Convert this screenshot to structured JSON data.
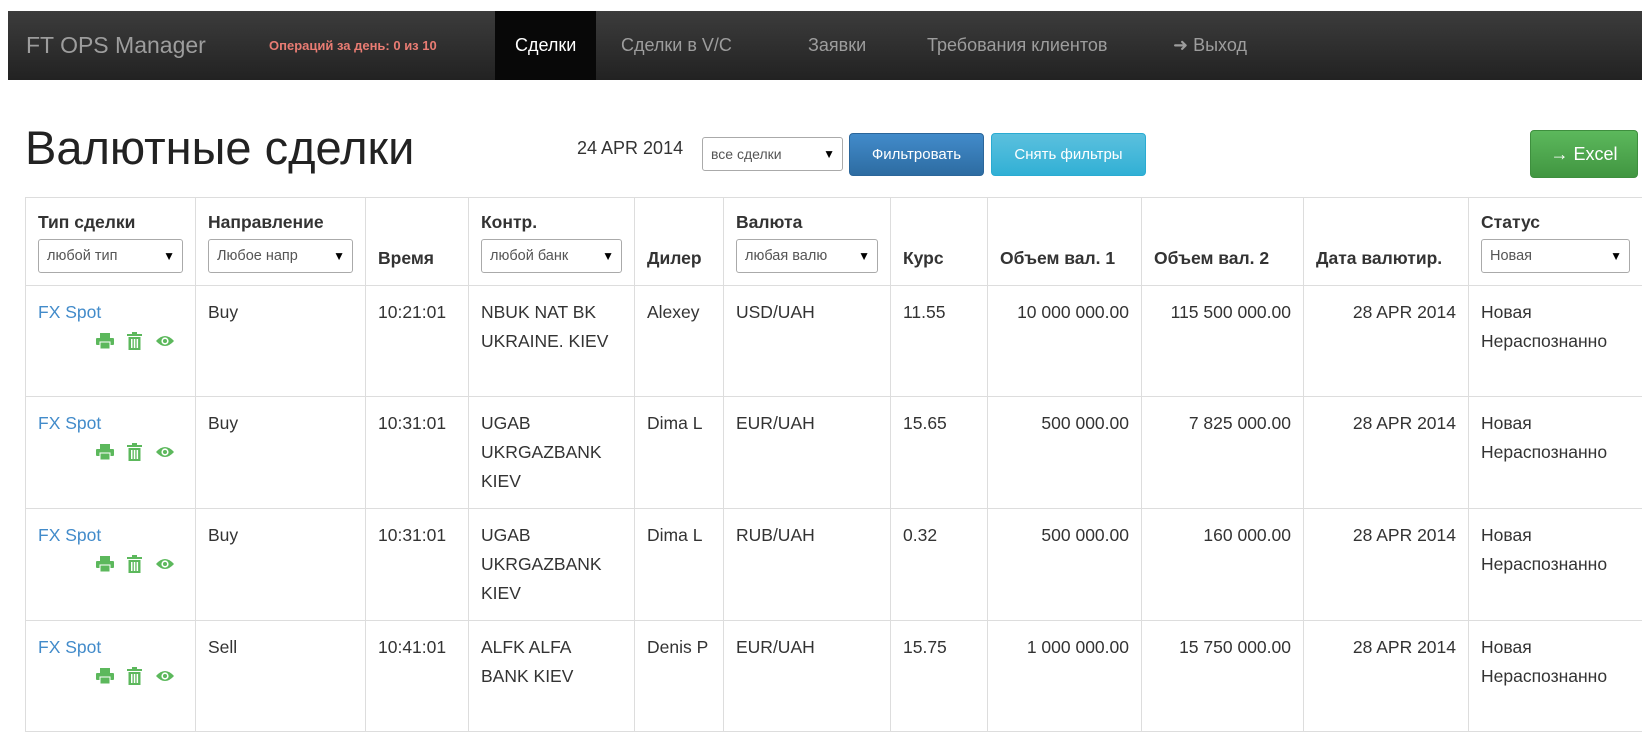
{
  "navbar": {
    "brand": "FT OPS Manager",
    "ops_count": "Операций за день: 0 из 10",
    "items": [
      {
        "label": "Сделки",
        "active": true
      },
      {
        "label": "Сделки в V/C",
        "active": false
      },
      {
        "label": "Заявки",
        "active": false
      },
      {
        "label": "Требования клиентов",
        "active": false
      },
      {
        "label": "➜ Выход",
        "active": false
      }
    ]
  },
  "page": {
    "title": "Валютные сделки",
    "date": "24 APR 2014",
    "deal_filter": "все сделки",
    "filter_button": "Фильтровать",
    "clear_button": "Снять фильтры",
    "excel_button": "→ Excel"
  },
  "table": {
    "headers": {
      "type": "Тип сделки",
      "type_filter": "любой тип",
      "direction": "Направление",
      "direction_filter": "Любое напр",
      "time": "Время",
      "counterparty": "Контр.",
      "counterparty_filter": "любой банк",
      "dealer": "Дилер",
      "currency": "Валюта",
      "currency_filter": "любая валю",
      "rate": "Курс",
      "volume1": "Объем вал. 1",
      "volume2": "Объем вал. 2",
      "value_date": "Дата валютир.",
      "status": "Статус",
      "status_filter": "Новая"
    },
    "rows": [
      {
        "type": "FX Spot",
        "direction": "Buy",
        "time": "10:21:01",
        "counterparty": "NBUK NAT BK UKRAINE. KIEV",
        "dealer": "Alexey",
        "currency": "USD/UAH",
        "rate": "11.55",
        "volume1": "10 000 000.00",
        "volume2": "115 500 000.00",
        "value_date": "28 APR 2014",
        "status": "Новая Нераспознанно"
      },
      {
        "type": "FX Spot",
        "direction": "Buy",
        "time": "10:31:01",
        "counterparty": "UGAB UKRGAZBANK KIEV",
        "dealer": "Dima L",
        "currency": "EUR/UAH",
        "rate": "15.65",
        "volume1": "500 000.00",
        "volume2": "7 825 000.00",
        "value_date": "28 APR 2014",
        "status": "Новая Нераспознанно"
      },
      {
        "type": "FX Spot",
        "direction": "Buy",
        "time": "10:31:01",
        "counterparty": "UGAB UKRGAZBANK KIEV",
        "dealer": "Dima L",
        "currency": "RUB/UAH",
        "rate": "0.32",
        "volume1": "500 000.00",
        "volume2": "160 000.00",
        "value_date": "28 APR 2014",
        "status": "Новая Нераспознанно"
      },
      {
        "type": "FX Spot",
        "direction": "Sell",
        "time": "10:41:01",
        "counterparty": "ALFK ALFA BANK KIEV",
        "dealer": "Denis P",
        "currency": "EUR/UAH",
        "rate": "15.75",
        "volume1": "1 000 000.00",
        "volume2": "15 750 000.00",
        "value_date": "28 APR 2014",
        "status": "Новая Нераспознанно"
      }
    ]
  },
  "icons": {
    "print": "print-icon",
    "delete": "trash-icon",
    "view": "eye-icon"
  },
  "colors": {
    "link": "#428bca",
    "action_icon": "#5cb85c",
    "ops_count": "#e97c73"
  }
}
